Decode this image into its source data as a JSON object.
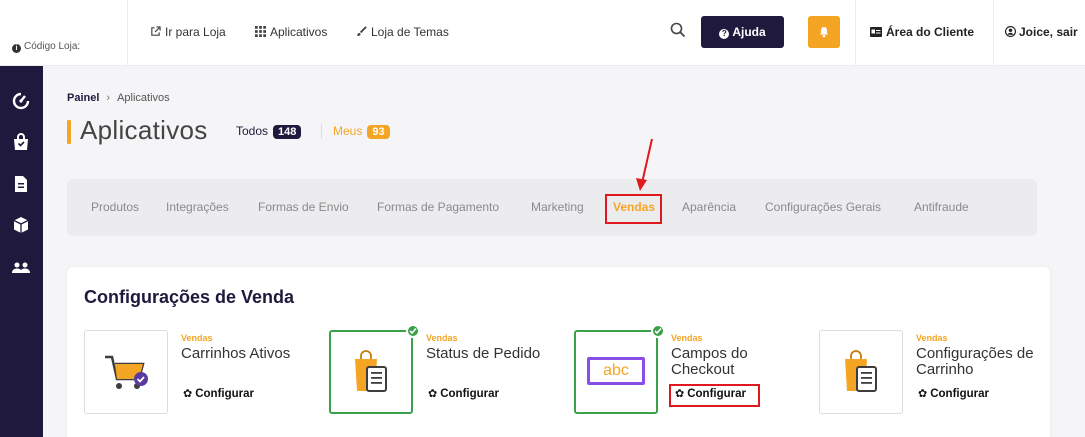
{
  "topbar": {
    "store_code_label": "Código Loja:",
    "links": [
      {
        "label": "Ir para Loja",
        "icon": "external-link-icon"
      },
      {
        "label": "Aplicativos",
        "icon": "grid-icon"
      },
      {
        "label": "Loja de Temas",
        "icon": "brush-icon"
      }
    ],
    "help_label": "Ajuda",
    "client_area_label": "Área do Cliente",
    "user_label": "Joice, sair"
  },
  "sidebar": {
    "items": [
      {
        "icon": "dashboard-icon"
      },
      {
        "icon": "shopping-bag-icon"
      },
      {
        "icon": "document-icon"
      },
      {
        "icon": "box-icon"
      },
      {
        "icon": "users-icon"
      }
    ]
  },
  "breadcrumb": {
    "home": "Painel",
    "current": "Aplicativos"
  },
  "page": {
    "title": "Aplicativos",
    "filters": [
      {
        "label": "Todos",
        "count": "148"
      },
      {
        "label": "Meus",
        "count": "93"
      }
    ]
  },
  "tabs": [
    {
      "label": "Produtos"
    },
    {
      "label": "Integrações"
    },
    {
      "label": "Formas de Envio"
    },
    {
      "label": "Formas de Pagamento"
    },
    {
      "label": "Marketing"
    },
    {
      "label": "Vendas",
      "active": true
    },
    {
      "label": "Aparência"
    },
    {
      "label": "Configurações Gerais"
    },
    {
      "label": "Antifraude"
    }
  ],
  "section": {
    "title": "Configurações de Venda",
    "apps": [
      {
        "category": "Vendas",
        "name_line1": "Carrinhos Ativos",
        "name_line2": "",
        "action": "Configurar",
        "installed": false,
        "icon": "cart-icon"
      },
      {
        "category": "Vendas",
        "name_line1": "Status de Pedido",
        "name_line2": "",
        "action": "Configurar",
        "installed": true,
        "icon": "order-status-icon"
      },
      {
        "category": "Vendas",
        "name_line1": "Campos do",
        "name_line2": "Checkout",
        "action": "Configurar",
        "installed": true,
        "icon": "abc-field-icon",
        "icon_text": "abc"
      },
      {
        "category": "Vendas",
        "name_line1": "Configurações de",
        "name_line2": "Carrinho",
        "action": "Configurar",
        "installed": false,
        "icon": "cart-settings-icon"
      }
    ]
  },
  "colors": {
    "brand_dark": "#1f1a3d",
    "accent": "#f5a524",
    "installed": "#3aa04a",
    "highlight": "#e0191f"
  }
}
